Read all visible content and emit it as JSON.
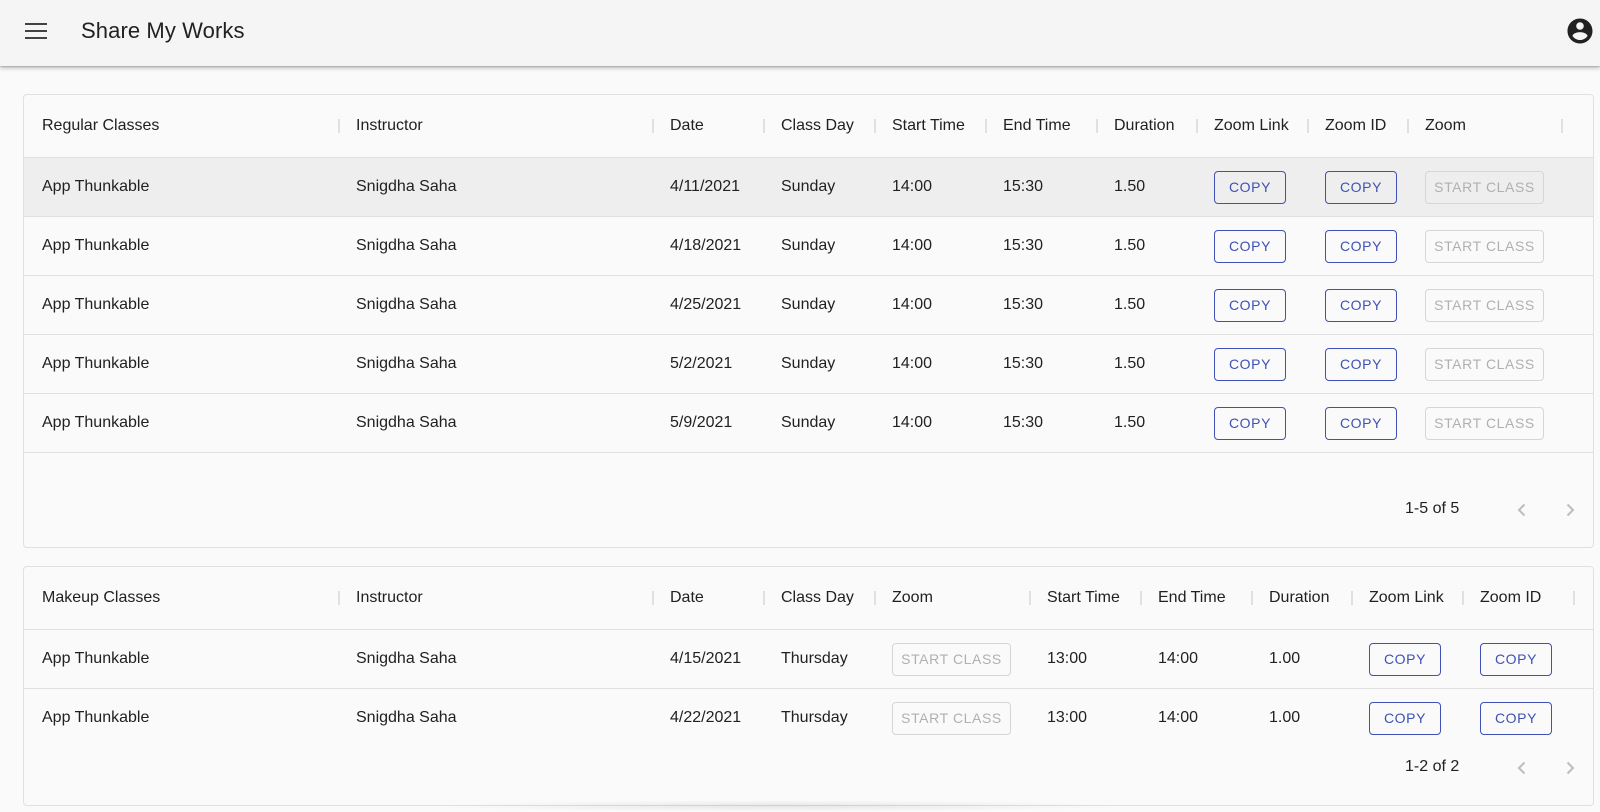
{
  "app": {
    "title": "Share My Works"
  },
  "regular": {
    "columns": [
      "Regular Classes",
      "Instructor",
      "Date",
      "Class Day",
      "Start Time",
      "End Time",
      "Duration",
      "Zoom Link",
      "Zoom ID",
      "Zoom"
    ],
    "rows": [
      {
        "cls": "App Thunkable",
        "instructor": "Snigdha Saha",
        "date": "4/11/2021",
        "day": "Sunday",
        "start": "14:00",
        "end": "15:30",
        "duration": "1.50",
        "selected": true
      },
      {
        "cls": "App Thunkable",
        "instructor": "Snigdha Saha",
        "date": "4/18/2021",
        "day": "Sunday",
        "start": "14:00",
        "end": "15:30",
        "duration": "1.50",
        "selected": false
      },
      {
        "cls": "App Thunkable",
        "instructor": "Snigdha Saha",
        "date": "4/25/2021",
        "day": "Sunday",
        "start": "14:00",
        "end": "15:30",
        "duration": "1.50",
        "selected": false
      },
      {
        "cls": "App Thunkable",
        "instructor": "Snigdha Saha",
        "date": "5/2/2021",
        "day": "Sunday",
        "start": "14:00",
        "end": "15:30",
        "duration": "1.50",
        "selected": false
      },
      {
        "cls": "App Thunkable",
        "instructor": "Snigdha Saha",
        "date": "5/9/2021",
        "day": "Sunday",
        "start": "14:00",
        "end": "15:30",
        "duration": "1.50",
        "selected": false
      }
    ],
    "pagination": "1-5 of 5"
  },
  "makeup": {
    "columns": [
      "Makeup Classes",
      "Instructor",
      "Date",
      "Class Day",
      "Zoom",
      "Start Time",
      "End Time",
      "Duration",
      "Zoom Link",
      "Zoom ID"
    ],
    "rows": [
      {
        "cls": "App Thunkable",
        "instructor": "Snigdha Saha",
        "date": "4/15/2021",
        "day": "Thursday",
        "start": "13:00",
        "end": "14:00",
        "duration": "1.00"
      },
      {
        "cls": "App Thunkable",
        "instructor": "Snigdha Saha",
        "date": "4/22/2021",
        "day": "Thursday",
        "start": "13:00",
        "end": "14:00",
        "duration": "1.00"
      }
    ],
    "pagination": "1-2 of 2"
  },
  "buttons": {
    "copy": "COPY",
    "start_class": "START CLASS"
  },
  "icons": {
    "menu": "menu-icon",
    "account": "account-circle-icon",
    "prev": "chevron-left-icon",
    "next": "chevron-right-icon"
  },
  "colors": {
    "primary": "#3f51b5",
    "disabled": "#b0b0b0",
    "selected_row": "#eeeeee"
  }
}
